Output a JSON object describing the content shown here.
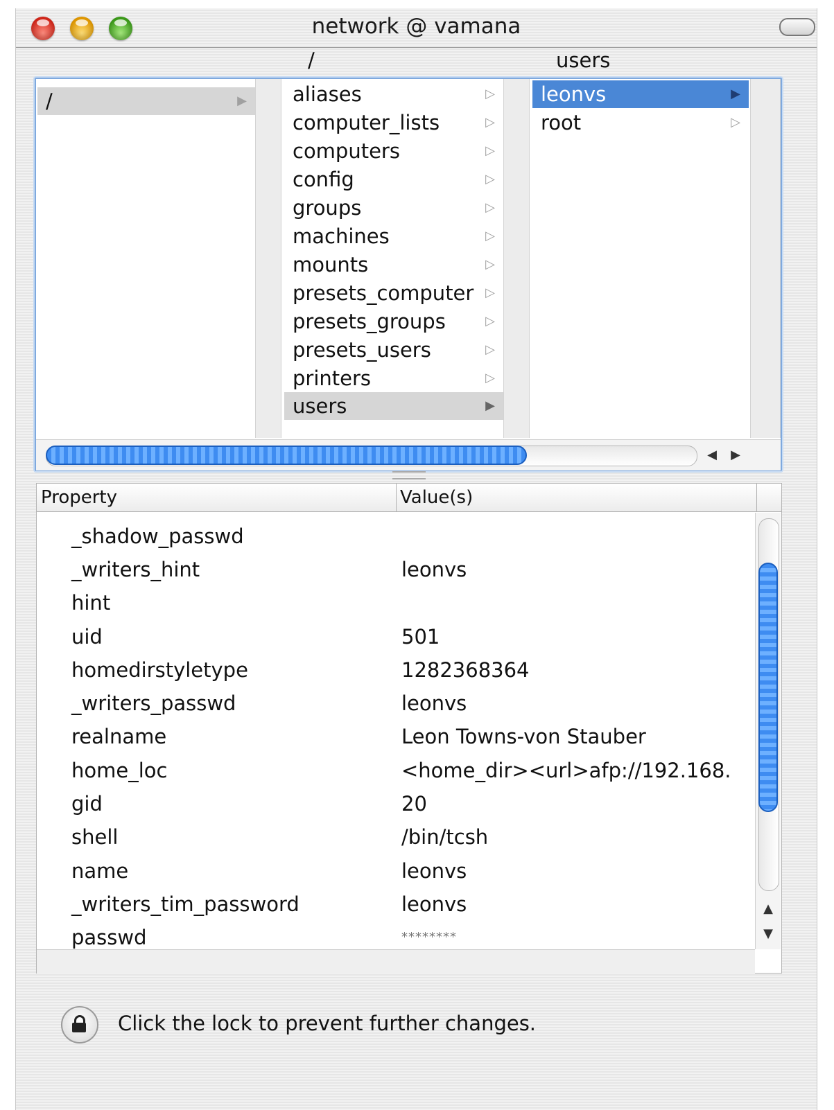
{
  "window": {
    "title": "network @ vamana"
  },
  "column_headers": [
    "/",
    "users"
  ],
  "columns": [
    {
      "items": [
        {
          "label": "/",
          "has_children": true,
          "selected": "gray"
        }
      ]
    },
    {
      "items": [
        {
          "label": "aliases"
        },
        {
          "label": "computer_lists"
        },
        {
          "label": "computers"
        },
        {
          "label": "config"
        },
        {
          "label": "groups"
        },
        {
          "label": "machines"
        },
        {
          "label": "mounts"
        },
        {
          "label": "presets_computer"
        },
        {
          "label": "presets_groups"
        },
        {
          "label": "presets_users"
        },
        {
          "label": "printers"
        },
        {
          "label": "users",
          "selected": "gray"
        }
      ]
    },
    {
      "items": [
        {
          "label": "leonvs",
          "selected": "blue"
        },
        {
          "label": "root"
        }
      ]
    }
  ],
  "table": {
    "headers": {
      "property": "Property",
      "values": "Value(s)"
    },
    "rows": [
      {
        "property": "_shadow_passwd",
        "value": ""
      },
      {
        "property": "_writers_hint",
        "value": "leonvs"
      },
      {
        "property": "hint",
        "value": ""
      },
      {
        "property": "uid",
        "value": "501"
      },
      {
        "property": "homedirstyletype",
        "value": "1282368364"
      },
      {
        "property": "_writers_passwd",
        "value": "leonvs"
      },
      {
        "property": "realname",
        "value": "Leon Towns-von Stauber"
      },
      {
        "property": "home_loc",
        "value": "<home_dir><url>afp://192.168."
      },
      {
        "property": "gid",
        "value": "20"
      },
      {
        "property": "shell",
        "value": "/bin/tcsh"
      },
      {
        "property": "name",
        "value": "leonvs"
      },
      {
        "property": "_writers_tim_password",
        "value": "leonvs"
      },
      {
        "property": "passwd",
        "value": "********"
      }
    ]
  },
  "status": {
    "lock_text": "Click the lock to prevent further changes."
  },
  "icons": {
    "close": "red-close-icon",
    "minimize": "yellow-minimize-icon",
    "zoom": "green-zoom-icon",
    "disclosure": "triangle-right-icon",
    "lock": "lock-icon"
  },
  "colors": {
    "selection": "#4a87d6",
    "accent": "#3e8cf1"
  }
}
